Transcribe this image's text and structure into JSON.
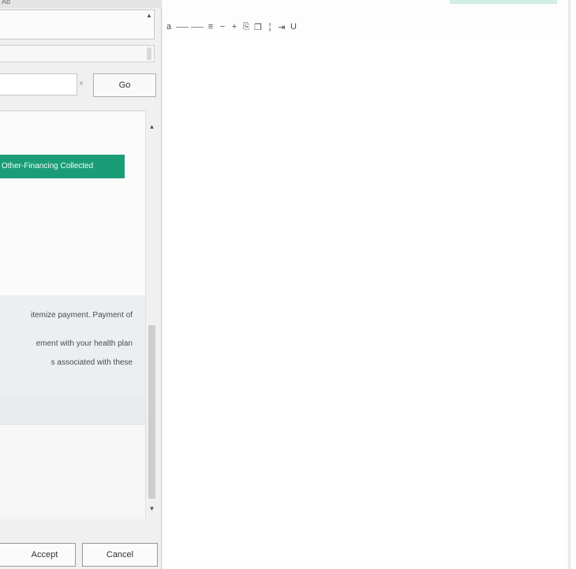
{
  "top_strip": {
    "label": "Ab"
  },
  "search": {
    "value": "",
    "placeholder": "",
    "button_label": "Go"
  },
  "list": {
    "selected_item": "Other-Financing Collected"
  },
  "description": {
    "lines": [
      "itemize payment. Payment of",
      "ement with your health plan",
      "s associated with these"
    ]
  },
  "footer": {
    "accept_label": "Accept",
    "cancel_label": "Cancel"
  },
  "toolbar": {
    "buttons": [
      {
        "name": "format-a-icon",
        "glyph": "a"
      },
      {
        "name": "dash-icon-1",
        "glyph": "—"
      },
      {
        "name": "dash-icon-2",
        "glyph": "—"
      },
      {
        "name": "list-icon",
        "glyph": "≡"
      },
      {
        "name": "minus-icon",
        "glyph": "−"
      },
      {
        "name": "plus-icon",
        "glyph": "+"
      },
      {
        "name": "paste-icon",
        "glyph": "⎘"
      },
      {
        "name": "copy-icon",
        "glyph": "❐"
      },
      {
        "name": "ruler-icon",
        "glyph": "¦"
      },
      {
        "name": "indent-icon",
        "glyph": "⇥"
      },
      {
        "name": "underline-icon",
        "glyph": "U"
      }
    ]
  },
  "colors": {
    "selected_bg": "#1a9c77",
    "accent_strip": "#cfeee6"
  }
}
